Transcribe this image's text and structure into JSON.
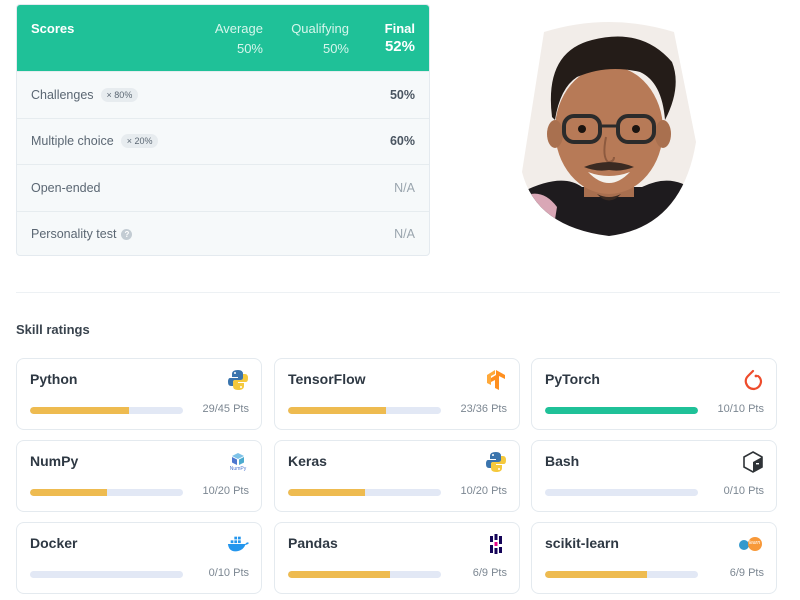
{
  "scores": {
    "title": "Scores",
    "average_label": "Average",
    "average_value": "50%",
    "qualifying_label": "Qualifying",
    "qualifying_value": "50%",
    "final_label": "Final",
    "final_value": "52%",
    "rows": [
      {
        "name": "Challenges",
        "weight": "× 80%",
        "value": "50%"
      },
      {
        "name": "Multiple choice",
        "weight": "× 20%",
        "value": "60%"
      },
      {
        "name": "Open-ended",
        "value": "N/A"
      },
      {
        "name": "Personality test",
        "help_icon": "?",
        "value": "N/A"
      }
    ]
  },
  "skills": {
    "title": "Skill ratings",
    "items": [
      {
        "name": "Python",
        "icon": "python-icon",
        "points": "29/45 Pts",
        "progress": 0.644
      },
      {
        "name": "TensorFlow",
        "icon": "tensorflow-icon",
        "points": "23/36 Pts",
        "progress": 0.639
      },
      {
        "name": "PyTorch",
        "icon": "pytorch-icon",
        "points": "10/10 Pts",
        "progress": 1.0
      },
      {
        "name": "NumPy",
        "icon": "numpy-icon",
        "icon_text": "NumPy",
        "points": "10/20 Pts",
        "progress": 0.5
      },
      {
        "name": "Keras",
        "icon": "python-icon",
        "points": "10/20 Pts",
        "progress": 0.5
      },
      {
        "name": "Bash",
        "icon": "bash-icon",
        "points": "0/10 Pts",
        "progress": 0.0
      },
      {
        "name": "Docker",
        "icon": "docker-icon",
        "points": "0/10 Pts",
        "progress": 0.0
      },
      {
        "name": "Pandas",
        "icon": "pandas-icon",
        "points": "6/9 Pts",
        "progress": 0.667
      },
      {
        "name": "scikit-learn",
        "icon": "scikit-learn-icon",
        "icon_text": "learn",
        "points": "6/9 Pts",
        "progress": 0.667
      }
    ]
  },
  "colors": {
    "accent": "#1fc198",
    "bar_fill": "#eebb50",
    "bar_track": "#e2e8f5"
  }
}
